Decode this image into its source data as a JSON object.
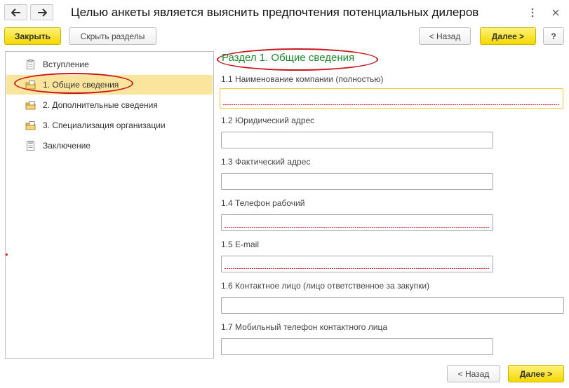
{
  "window": {
    "title": "Целью анкеты является выяснить предпочтения потенциальных дилеров",
    "icons": [
      "back-arrow-icon",
      "forward-arrow-icon",
      "more-vertical-icon",
      "close-icon"
    ]
  },
  "toolbar": {
    "close_label": "Закрыть",
    "hide_sections_label": "Скрыть разделы",
    "back_label": "< Назад",
    "next_label": "Далее >",
    "help_label": "?"
  },
  "tree": {
    "items": [
      {
        "label": "Вступление",
        "icon": "document-icon",
        "selected": false
      },
      {
        "label": "1. Общие сведения",
        "icon": "folder-document-icon",
        "selected": true
      },
      {
        "label": "2. Дополнительные сведения",
        "icon": "folder-document-icon",
        "selected": false
      },
      {
        "label": "3. Специализация организации",
        "icon": "folder-document-icon",
        "selected": false
      },
      {
        "label": "Заключение",
        "icon": "document-icon",
        "selected": false
      }
    ]
  },
  "form": {
    "section_title": "Раздел 1. Общие сведения",
    "fields": [
      {
        "label": "1.1 Наименование компании (полностью)",
        "value": "",
        "required": true,
        "focused": true
      },
      {
        "label": "1.2 Юридический адрес",
        "value": "",
        "required": false
      },
      {
        "label": "1.3 Фактический адрес",
        "value": "",
        "required": false
      },
      {
        "label": "1.4 Телефон рабочий",
        "value": "",
        "required": true
      },
      {
        "label": "1.5 E-mail",
        "value": "",
        "required": true
      },
      {
        "label": "1.6 Контактное лицо (лицо ответственное за закупки)",
        "value": "",
        "required": false
      },
      {
        "label": "1.7 Мобильный телефон контактного лица",
        "value": "",
        "required": false
      }
    ]
  },
  "footer": {
    "back_label": "< Назад",
    "next_label": "Далее >"
  },
  "colors": {
    "accent_yellow": "#f5d800",
    "selection": "#fbe49b",
    "section_title": "#1e8a2e",
    "annotation_red": "#c8161d"
  }
}
